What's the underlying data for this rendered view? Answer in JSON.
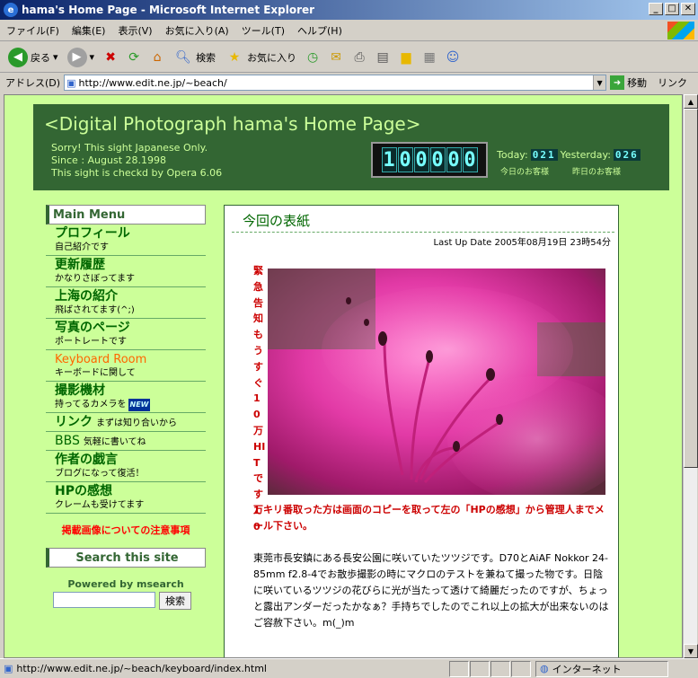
{
  "window": {
    "title": "hama's Home Page - Microsoft Internet Explorer"
  },
  "menu": [
    "ファイル(F)",
    "編集(E)",
    "表示(V)",
    "お気に入り(A)",
    "ツール(T)",
    "ヘルプ(H)"
  ],
  "toolbar": {
    "back": "戻る",
    "search": "検索",
    "favorites": "お気に入り"
  },
  "address": {
    "label": "アドレス(D)",
    "url": "http://www.edit.ne.jp/~beach/",
    "go": "移動",
    "links": "リンク"
  },
  "header": {
    "title": "<Digital Photograph hama's Home Page>",
    "line1": "Sorry! This sight Japanese Only.",
    "line2": "Since : August 28.1998",
    "line3": "This sight is checkd by Opera 6.06",
    "counter": "100000",
    "today_label": "Today:",
    "today_value": "021",
    "yesterday_label": "Yesterday:",
    "yesterday_value": "026",
    "today_visitors": "今日のお客様",
    "yesterday_visitors": "昨日のお客様"
  },
  "sidebar": {
    "heading": "Main Menu",
    "items": [
      {
        "title": "プロフィール",
        "desc": "自己紹介です"
      },
      {
        "title": "更新履歴",
        "desc": "かなりさぼってます"
      },
      {
        "title": "上海の紹介",
        "desc": "飛ばされてます(^;)"
      },
      {
        "title": "写真のページ",
        "desc": "ポートレートです"
      },
      {
        "title": "Keyboard Room",
        "desc": "キーボードに関して"
      },
      {
        "title": "撮影機材",
        "desc": "持ってるカメラを",
        "badge": "NEW"
      },
      {
        "title": "リンク",
        "desc": "まずは知り合いから"
      },
      {
        "title": "BBS",
        "desc": "気軽に書いてね"
      },
      {
        "title": "作者の戯言",
        "desc": "ブログになって復活！"
      },
      {
        "title": "HPの感想",
        "desc": "クレームも受けてます"
      }
    ],
    "notice": "掲載画像についての注意事項",
    "search_heading": "Search this site",
    "powered": "Powered by msearch",
    "search_button": "検索"
  },
  "main": {
    "heading": "今回の表紙",
    "last_update": "Last Up Date 2005年08月19日 23時54分",
    "urgent_vertical": "緊急告知もうすぐ10万HITです10",
    "urgent_line": "万キリ番取った方は画面のコピーを取って左の「HPの感想」から管理人までメール下さい。",
    "body": "東莞市長安鎮にある長安公園に咲いていたツツジです。D70とAiAF Nokkor 24-85mm f2.8-4でお散歩撮影の時にマクロのテストを兼ねて撮った物です。日陰に咲いているツツジの花びらに光が当たって透けて綺麗だったのですが、ちょっと露出アンダーだったかなぁ？手持ちでしたのでこれ以上の拡大が出来ないのはご容赦下さい。m(_)m"
  },
  "status": {
    "url": "http://www.edit.ne.jp/~beach/keyboard/index.html",
    "zone": "インターネット"
  }
}
